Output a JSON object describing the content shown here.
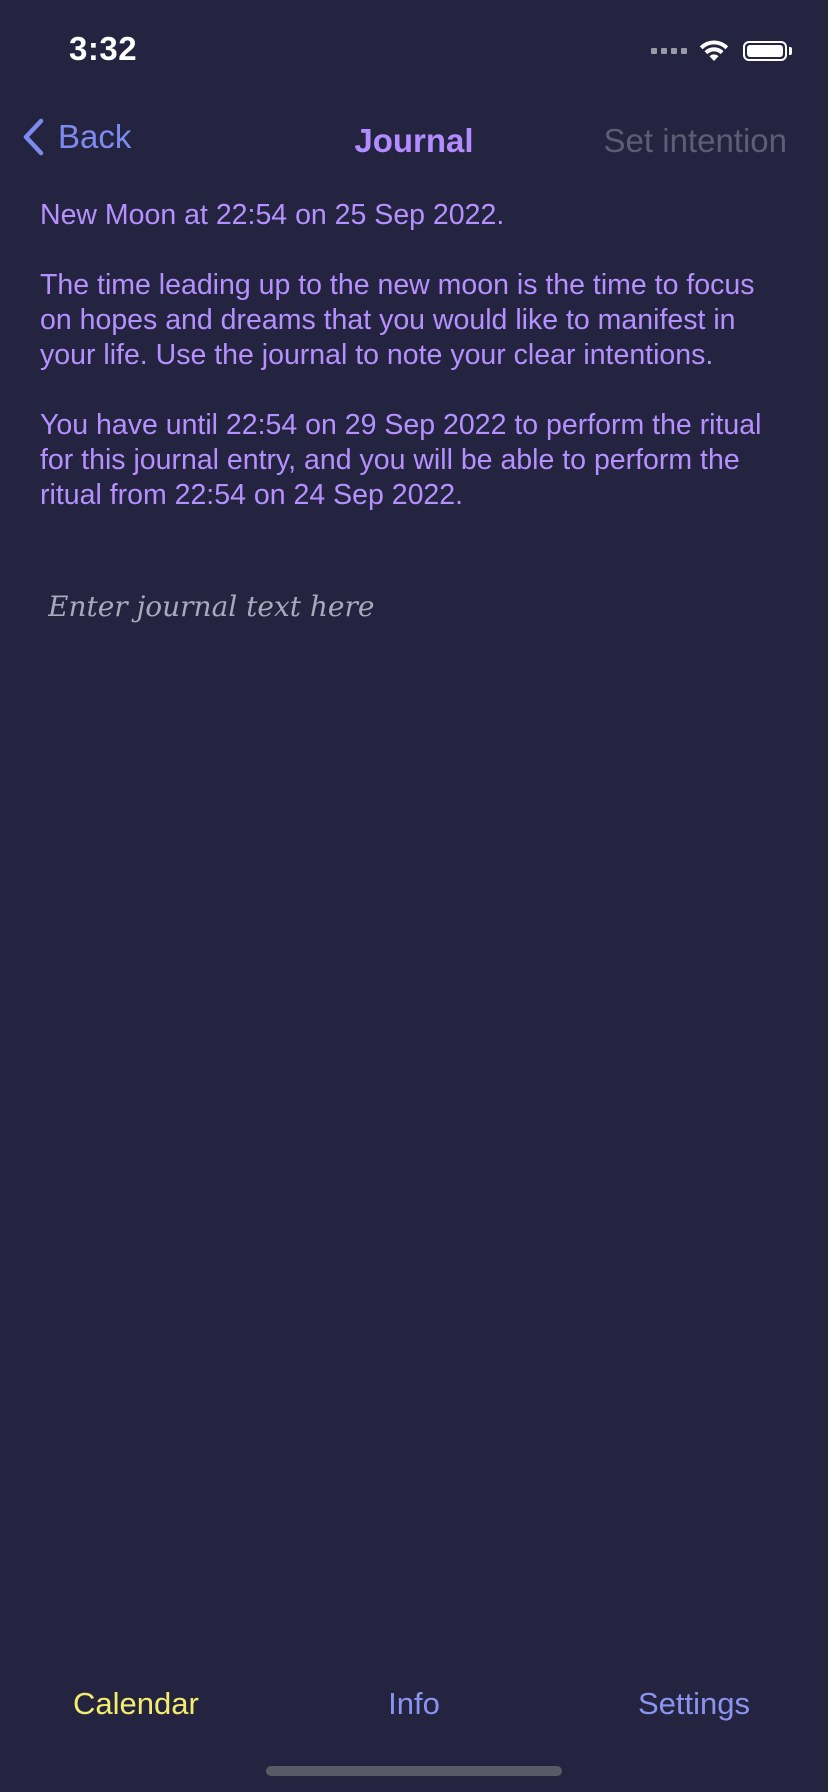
{
  "status_bar": {
    "time": "3:32"
  },
  "nav": {
    "back_label": "Back",
    "title": "Journal",
    "action_label": "Set intention"
  },
  "content": {
    "paragraphs": [
      "New Moon at 22:54 on 25 Sep 2022.",
      "The time leading up to the new moon is the time to focus on hopes and dreams that you would like to manifest in your life. Use the journal to note your clear intentions.",
      "You have until 22:54 on 29 Sep 2022 to perform the ritual for this journal entry, and you will be able to perform the ritual from 22:54 on 24 Sep 2022."
    ]
  },
  "journal": {
    "placeholder": "Enter journal text here",
    "value": ""
  },
  "tabs": [
    {
      "label": "Calendar",
      "active": true
    },
    {
      "label": "Info",
      "active": false
    },
    {
      "label": "Settings",
      "active": false
    }
  ],
  "colors": {
    "background": "#242440",
    "accent": "#7d8bf0",
    "title": "#b38cff",
    "body_text": "#b590ff",
    "active_tab": "#f4ec6e",
    "disabled": "#5d5d74"
  },
  "icons": [
    "chevron-left-icon",
    "signal-icon",
    "wifi-icon",
    "battery-icon"
  ]
}
